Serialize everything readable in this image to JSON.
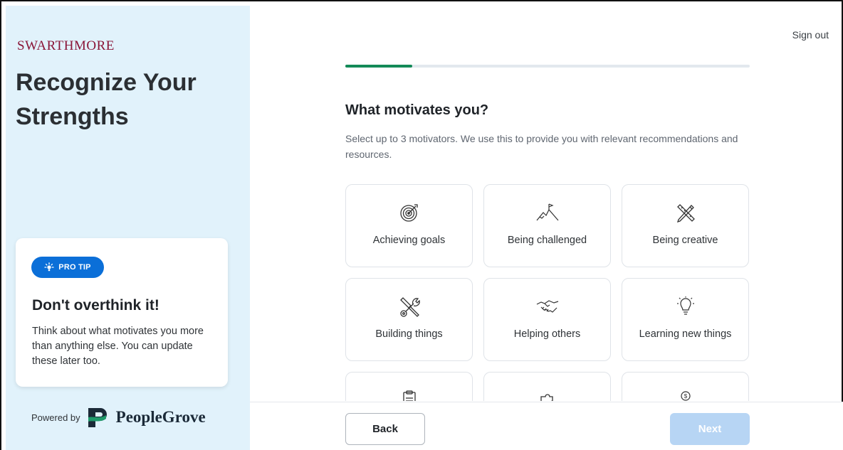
{
  "sidebar": {
    "brand": "SWARTHMORE",
    "title_line1": "Recognize Your",
    "title_line2": "Strengths",
    "tip": {
      "badge": "PRO TIP",
      "title": "Don't overthink it!",
      "text": "Think about what motivates you more than anything else. You can update these later too."
    },
    "powered_by": "Powered by",
    "powered_brand": "PeopleGrove"
  },
  "header": {
    "sign_out": "Sign out"
  },
  "progress": {
    "fraction": 0.165
  },
  "main": {
    "question": "What motivates you?",
    "subtitle": "Select up to 3 motivators. We use this to provide you with relevant recommendations and resources.",
    "options": [
      {
        "label": "Achieving goals",
        "icon": "target-icon"
      },
      {
        "label": "Being challenged",
        "icon": "mountain-flag-icon"
      },
      {
        "label": "Being creative",
        "icon": "pencil-ruler-icon"
      },
      {
        "label": "Building things",
        "icon": "tools-icon"
      },
      {
        "label": "Helping others",
        "icon": "handshake-icon"
      },
      {
        "label": "Learning new things",
        "icon": "lightbulb-icon"
      },
      {
        "label": "",
        "icon": "clipboard-icon"
      },
      {
        "label": "",
        "icon": "puzzle-icon"
      },
      {
        "label": "",
        "icon": "money-hand-icon"
      }
    ]
  },
  "footer": {
    "back_label": "Back",
    "next_label": "Next"
  },
  "colors": {
    "accent": "#0b6fd8",
    "progress": "#138a58",
    "brand": "#8a1538",
    "panel": "#e1f2fb"
  }
}
